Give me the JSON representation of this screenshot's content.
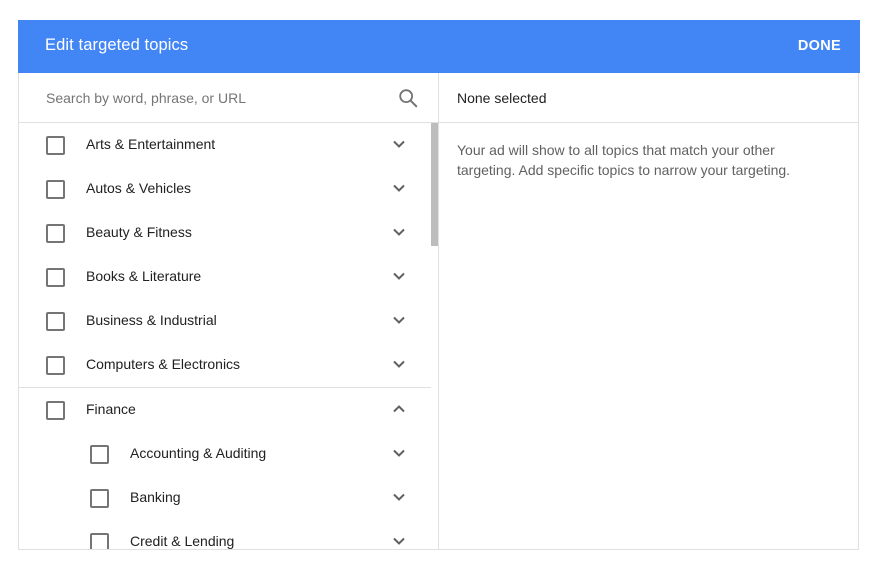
{
  "dialog": {
    "title": "Edit targeted topics",
    "done_label": "DONE",
    "accent_color": "#4285f4"
  },
  "search": {
    "placeholder": "Search by word, phrase, or URL",
    "value": "",
    "icon": "search-icon"
  },
  "topics": [
    {
      "label": "Arts & Entertainment",
      "level": 0,
      "checked": false,
      "expanded": false
    },
    {
      "label": "Autos & Vehicles",
      "level": 0,
      "checked": false,
      "expanded": false
    },
    {
      "label": "Beauty & Fitness",
      "level": 0,
      "checked": false,
      "expanded": false
    },
    {
      "label": "Books & Literature",
      "level": 0,
      "checked": false,
      "expanded": false
    },
    {
      "label": "Business & Industrial",
      "level": 0,
      "checked": false,
      "expanded": false
    },
    {
      "label": "Computers & Electronics",
      "level": 0,
      "checked": false,
      "expanded": false
    },
    {
      "label": "Finance",
      "level": 0,
      "checked": false,
      "expanded": true
    },
    {
      "label": "Accounting & Auditing",
      "level": 1,
      "checked": false,
      "expanded": false
    },
    {
      "label": "Banking",
      "level": 1,
      "checked": false,
      "expanded": false
    },
    {
      "label": "Credit & Lending",
      "level": 1,
      "checked": false,
      "expanded": false
    }
  ],
  "selected_panel": {
    "header": "None selected",
    "info": "Your ad will show to all topics that match your other targeting. Add specific topics to narrow your targeting."
  }
}
